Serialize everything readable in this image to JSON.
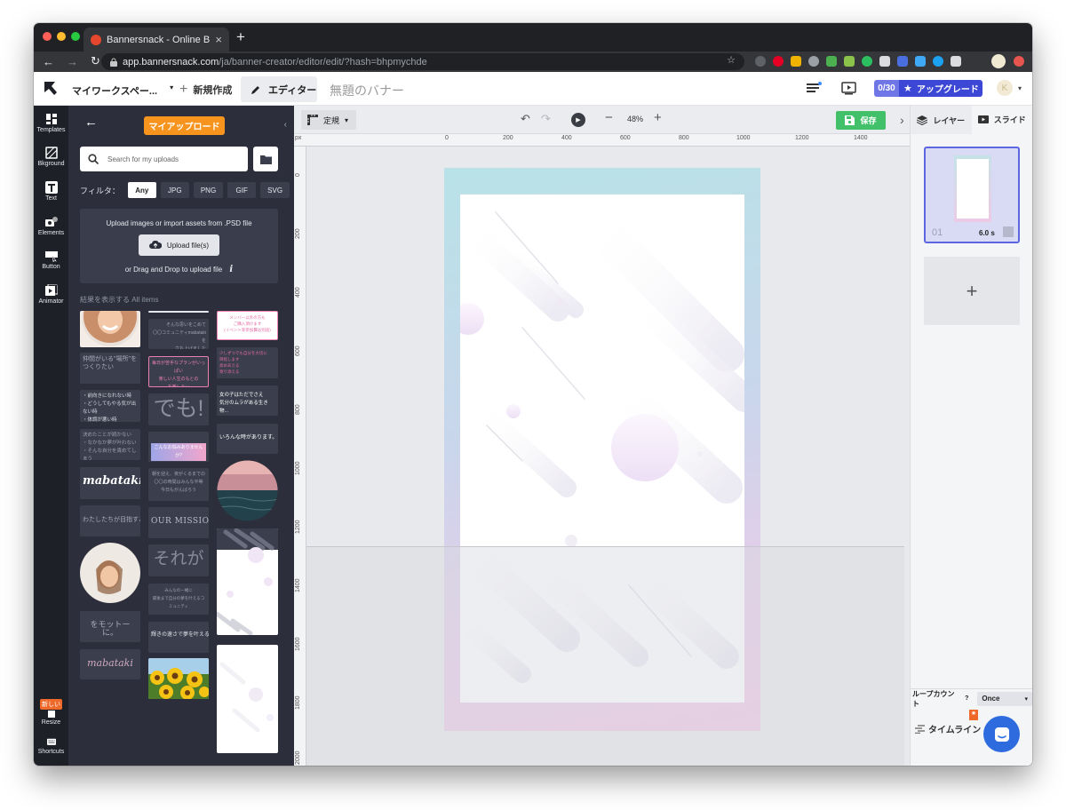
{
  "browser": {
    "tab_title": "Bannersnack - Online Banner Ma",
    "tab_close": "×",
    "new_tab": "+",
    "url_host": "app.bannersnack.com",
    "url_path": "/ja/banner-creator/editor/edit/?hash=bhpmychde",
    "nav_back": "←",
    "nav_forward": "→",
    "nav_reload": "↻",
    "bookmark": "☆"
  },
  "header": {
    "project": "マイワークスペー...",
    "project_caret": "▾",
    "new_label": "新規作成",
    "new_plus": "+",
    "editor_label": "エディター",
    "banner_name": "無題のバナー",
    "quota": "0/30",
    "upgrade": "アップグレード",
    "avatar": "K",
    "caret": "▾"
  },
  "rail": [
    {
      "label": "Templates",
      "color": "#ffffff"
    },
    {
      "label": "Bkground",
      "color": "#ffffff"
    },
    {
      "label": "Text",
      "color": "#ffffff"
    },
    {
      "label": "Elements",
      "color": "#ffffff"
    },
    {
      "label": "Button",
      "color": "#ffffff"
    },
    {
      "label": "Animator",
      "color": "#ffffff"
    }
  ],
  "rail_bottom": {
    "new_badge": "新しい",
    "resize": "Resize",
    "shortcuts": "Shortcuts"
  },
  "panel": {
    "back": "←",
    "tab_label": "マイアップロード",
    "collapse": "‹",
    "search_placeholder": "Search for my uploads",
    "filter_label": "フィルタ：",
    "filters": [
      "Any",
      "JPG",
      "PNG",
      "GIF",
      "SVG"
    ],
    "dropzone_title": "Upload images or import assets from .PSD file",
    "upload_button": "Upload file(s)",
    "dropzone_hint": "or Drag and Drop to upload file",
    "info": "i",
    "results_label": "結果を表示する",
    "results_filter": "All items"
  },
  "thumbs": {
    "c1": [
      "仲間がいる\"場所\"を\nつくりたい",
      "・前向きになれない時\n・どうしてもやる気が出ない時\n・体調が悪い時",
      "決めたことが続かない\n・なかなか夢が叶わない\n・そんな自分を責めてしまう",
      "mabataki",
      "わたしたちが目指すこと",
      "をモットーに。",
      "mabataki"
    ],
    "c2": [
      "そんな思いをこめて\n〇〇コミュニティmabatakiを\n立ち上げました",
      "毎日が苦手なプランがいっぱい\n楽しい人生のもとの\nお楽しみぃ",
      "でも!",
      "こんなお悩みありませんか?",
      "朝を迎え、夜がくるまでの\n〇〇の時間はみんな平等\n今日もがんばろう",
      "OUR MISSION",
      "それが",
      "みんなの一緒に\n最後まで自分の夢を叶えるコミュニティ",
      "輝きの速さで夢を叶える"
    ],
    "c3": [
      "メンバー以外の方も\nご購入頂けます\n(イベント等参加費は別途)",
      "少しずつでも自分を大切に\n目指します\n高めあえる\n寄り添える",
      "女の子はただでさえ\n気分のムラがある生き物...",
      "いろんな時があります。"
    ]
  },
  "canvas_toolbar": {
    "size_label": "定規",
    "size_caret": "▾",
    "undo": "↶",
    "redo": "↷",
    "play": "▶",
    "zoom_out": "−",
    "zoom": "48%",
    "zoom_in": "+",
    "save": "保存",
    "expand": "›"
  },
  "rulers": {
    "unit": "px",
    "x": [
      "0",
      "200",
      "400",
      "600",
      "800",
      "1000",
      "1200",
      "1400"
    ],
    "y": [
      "0",
      "200",
      "400",
      "600",
      "800",
      "1000",
      "1200",
      "1400",
      "1600",
      "1800",
      "2000"
    ]
  },
  "right_panel": {
    "layers_tab": "レイヤー",
    "slides_tab": "スライド",
    "slide_number": "01",
    "slide_duration": "6.0 s",
    "add_slide": "+",
    "loop_label": "ループカウント",
    "loop_help": "?",
    "loop_value": "Once",
    "loop_caret": "▾",
    "timeline": "タイムライン",
    "timeline_badge": "★"
  },
  "colors": {
    "accent_orange": "#f7941d",
    "save_green": "#43c06a",
    "upgrade_blue": "#3d47d6",
    "dark_panel": "#2c2f3b",
    "rail": "#1d2027"
  }
}
